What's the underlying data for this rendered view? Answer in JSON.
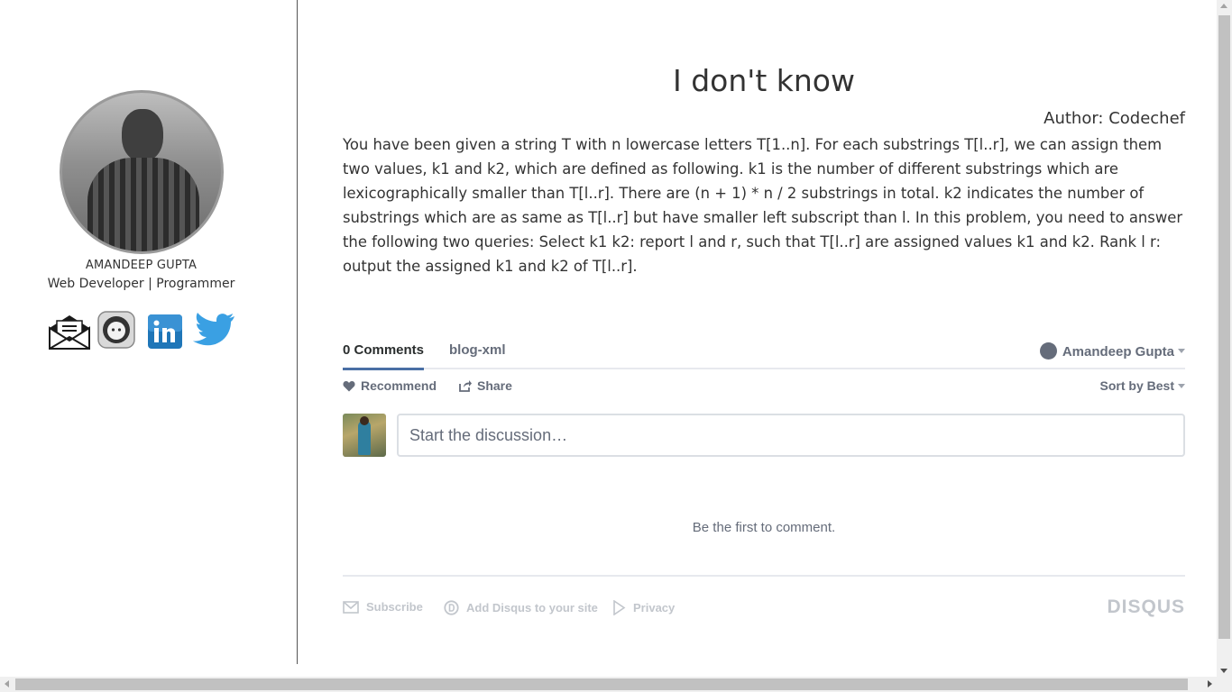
{
  "profile": {
    "name": "AMANDEEP GUPTA",
    "role": "Web Developer | Programmer",
    "social_icons": [
      "mail-icon",
      "github-icon",
      "linkedin-icon",
      "twitter-icon"
    ]
  },
  "post": {
    "title": "I don't know",
    "author": "Author: Codechef",
    "body": "You have been given a string T with n lowercase letters T[1..n]. For each substrings T[l..r], we can assign them two values, k1 and k2, which are defined as following. k1 is the number of different substrings which are lexicographically smaller than T[l..r]. There are (n + 1) * n / 2 substrings in total. k2 indicates the number of substrings which are as same as T[l..r] but have smaller left subscript than l. In this problem, you need to answer the following two queries: Select k1 k2: report l and r, such that T[l..r] are assigned values k1 and k2. Rank l r: output the assigned k1 and k2 of T[l..r]."
  },
  "comments": {
    "tab_comments": "0 Comments",
    "tab_forum": "blog-xml",
    "user": "Amandeep Gupta",
    "recommend": "Recommend",
    "share": "Share",
    "sort": "Sort by Best",
    "placeholder": "Start the discussion…",
    "empty": "Be the first to comment.",
    "footer": {
      "subscribe": "Subscribe",
      "add": "Add Disqus to your site",
      "privacy": "Privacy",
      "logo": "DISQUS"
    }
  },
  "colors": {
    "accent": "#4a6fa5",
    "muted": "#656c7a",
    "footer_text": "#c2c6cc"
  }
}
